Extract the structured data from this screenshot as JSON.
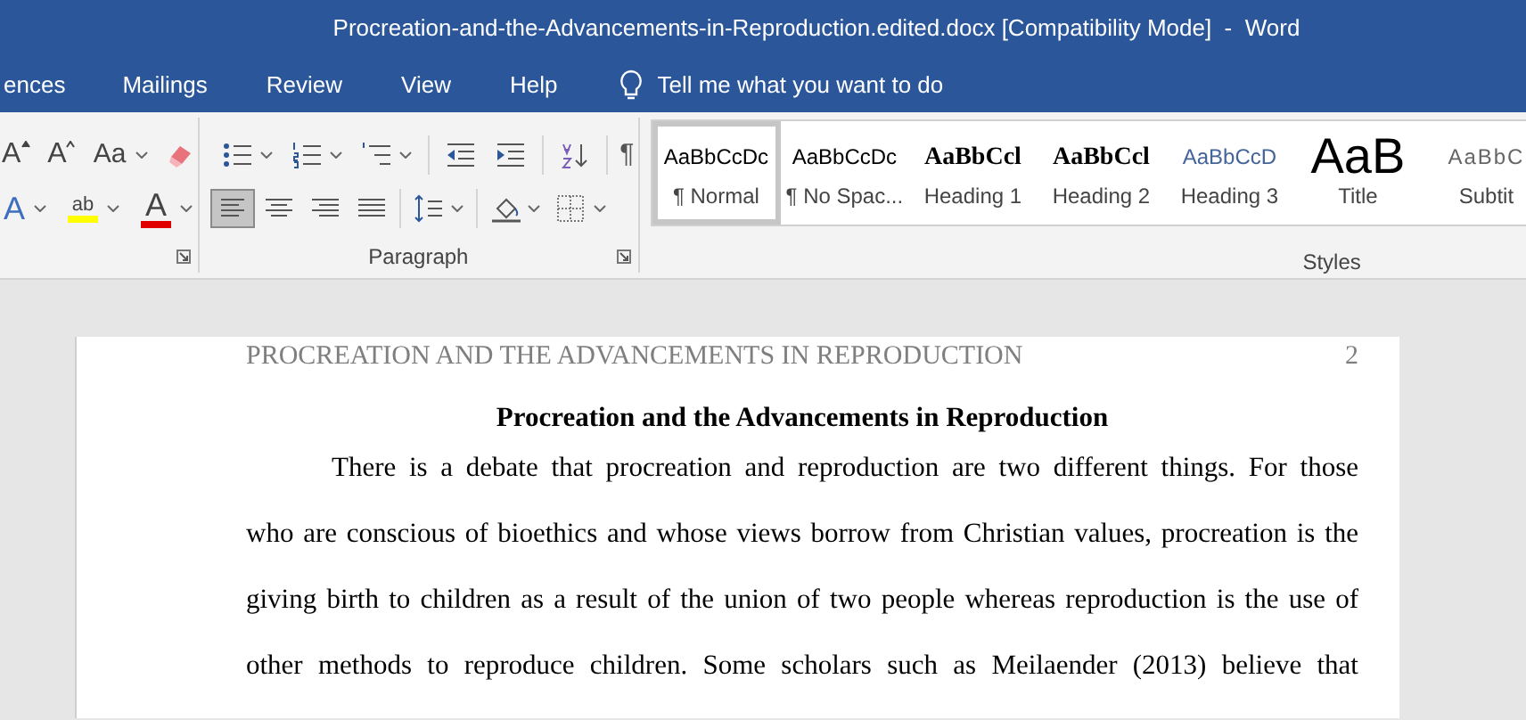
{
  "window": {
    "title": "Procreation-and-the-Advancements-in-Reproduction.edited.docx [Compatibility Mode]  -  Word"
  },
  "ribbon_tabs": [
    {
      "label": "ences",
      "selected": false
    },
    {
      "label": "Mailings",
      "selected": false
    },
    {
      "label": "Review",
      "selected": false
    },
    {
      "label": "View",
      "selected": false
    },
    {
      "label": "Help",
      "selected": false
    }
  ],
  "tell_me": {
    "placeholder": "Tell me what you want to do"
  },
  "font_group": {
    "row1": [
      {
        "kind": "grow",
        "glyph": "A"
      },
      {
        "kind": "shrink",
        "glyph": "A"
      },
      {
        "kind": "case",
        "glyph": "Aa"
      },
      {
        "kind": "clear"
      }
    ],
    "row2": [
      {
        "kind": "effects",
        "glyph": "A"
      },
      {
        "kind": "highlight",
        "glyph": "ab"
      },
      {
        "kind": "fontcolor",
        "glyph": "A"
      }
    ]
  },
  "paragraph_group": {
    "label": "Paragraph",
    "row1": [
      {
        "kind": "bullets"
      },
      {
        "kind": "numbering"
      },
      {
        "kind": "multilevel"
      },
      {
        "kind": "outdent"
      },
      {
        "kind": "indent"
      },
      {
        "kind": "sort"
      },
      {
        "kind": "pilcrow",
        "glyph": "¶"
      }
    ],
    "row2": [
      {
        "kind": "left",
        "selected": true
      },
      {
        "kind": "center",
        "selected": false
      },
      {
        "kind": "right",
        "selected": false
      },
      {
        "kind": "justify",
        "selected": false
      },
      {
        "kind": "spacing"
      },
      {
        "kind": "shading"
      },
      {
        "kind": "borders"
      }
    ]
  },
  "styles_group": {
    "label": "Styles",
    "items": [
      {
        "preview": "AaBbCcDc",
        "name": "¶ Normal",
        "kind": "normal",
        "selected": true
      },
      {
        "preview": "AaBbCcDc",
        "name": "¶ No Spac...",
        "kind": "normal",
        "selected": false
      },
      {
        "preview": "AaBbCcl",
        "name": "Heading 1",
        "kind": "heading",
        "selected": false
      },
      {
        "preview": "AaBbCcl",
        "name": "Heading 2",
        "kind": "heading",
        "selected": false
      },
      {
        "preview": "AaBbCcD",
        "name": "Heading 3",
        "kind": "subheading",
        "selected": false
      },
      {
        "preview": "AaB",
        "name": "Title",
        "kind": "title",
        "selected": false
      },
      {
        "preview": "AaBbC",
        "name": "Subtit",
        "kind": "subtitle",
        "selected": false
      }
    ]
  },
  "document": {
    "header": "PROCREATION AND THE ADVANCEMENTS IN REPRODUCTION",
    "page_number": "2",
    "title": "Procreation and the Advancements in Reproduction",
    "lines": [
      "There is a debate that procreation and reproduction are two different things. For those",
      "who are conscious of bioethics and whose views borrow from Christian values, procreation is the",
      "giving birth to children as a result of the union of two people whereas reproduction is the use of",
      "other methods to reproduce children. Some scholars such as Meilaender (2013) believe that"
    ]
  }
}
